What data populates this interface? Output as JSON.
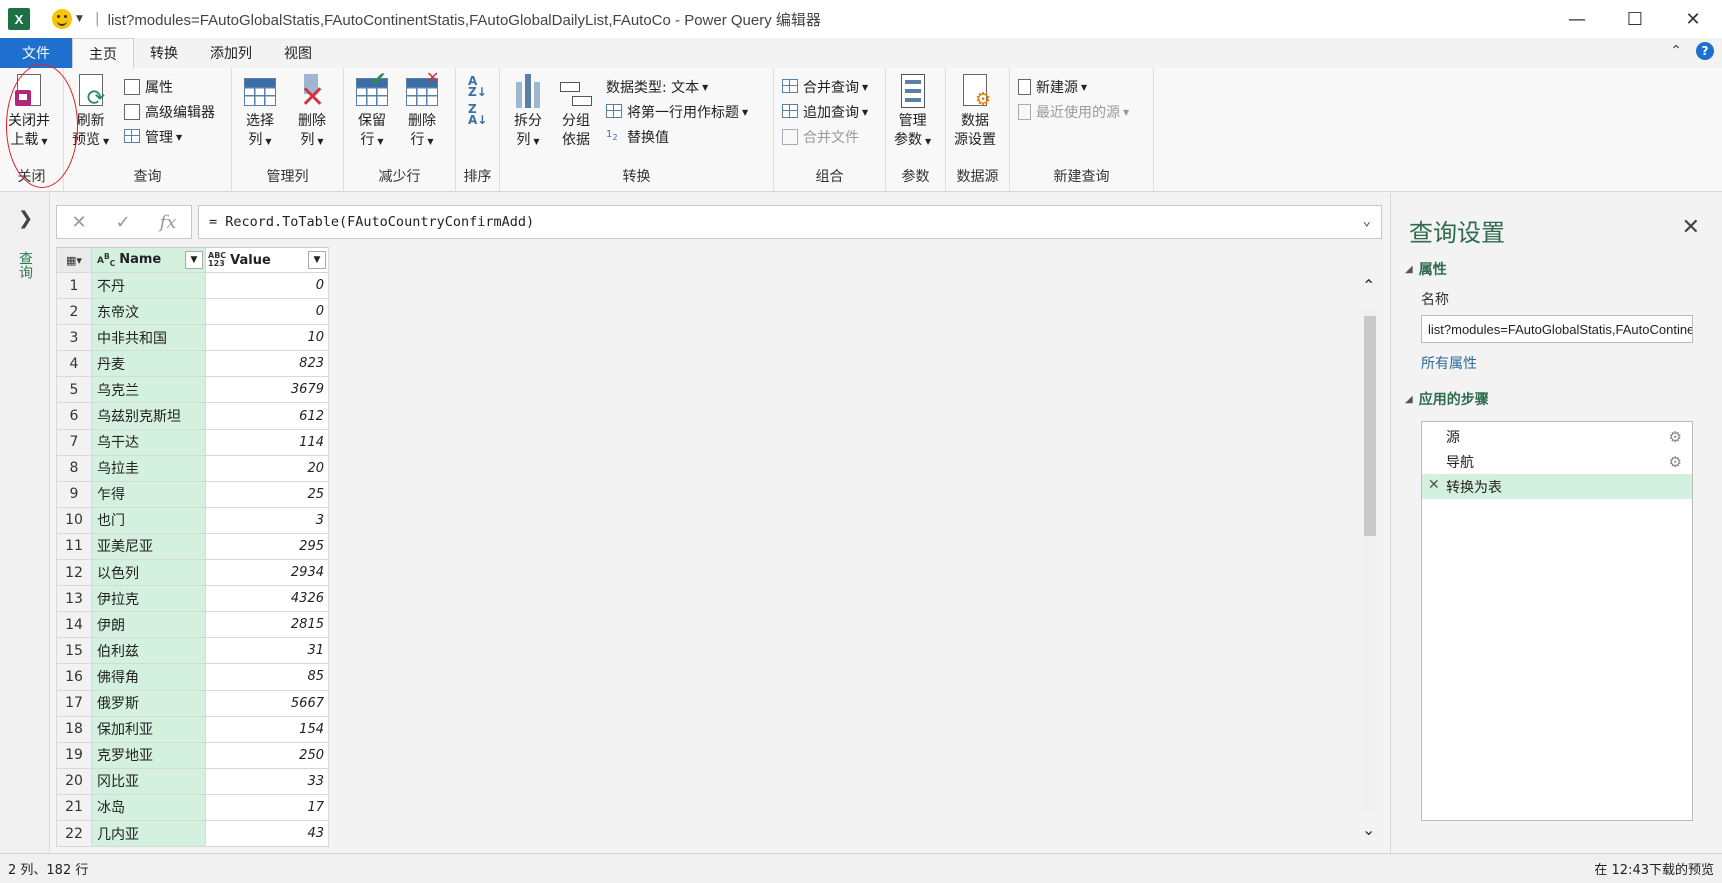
{
  "titlebar": {
    "app_icon": "excel-icon",
    "title": "list?modules=FAutoGlobalStatis,FAutoContinentStatis,FAutoGlobalDailyList,FAutoCo - Power Query 编辑器"
  },
  "tabs": {
    "file": "文件",
    "items": [
      {
        "label": "主页",
        "active": true
      },
      {
        "label": "转换"
      },
      {
        "label": "添加列"
      },
      {
        "label": "视图"
      }
    ]
  },
  "ribbon": {
    "close": {
      "btn_line1": "关闭并",
      "btn_line2": "上载",
      "label": "关闭"
    },
    "query": {
      "refresh_line1": "刷新",
      "refresh_line2": "预览",
      "properties": "属性",
      "advanced_editor": "高级编辑器",
      "manage": "管理",
      "label": "查询"
    },
    "manage_columns": {
      "choose_line1": "选择",
      "choose_line2": "列",
      "remove_line1": "删除",
      "remove_line2": "列",
      "label": "管理列"
    },
    "reduce_rows": {
      "keep_line1": "保留",
      "keep_line2": "行",
      "remove_line1": "删除",
      "remove_line2": "行",
      "label": "减少行"
    },
    "sort": {
      "label": "排序"
    },
    "transform": {
      "split_line1": "拆分",
      "split_line2": "列",
      "group_line1": "分组",
      "group_line2": "依据",
      "data_type": "数据类型: 文本",
      "first_row_header": "将第一行用作标题",
      "replace_values": "替换值",
      "label": "转换"
    },
    "combine": {
      "merge_queries": "合并查询",
      "append_queries": "追加查询",
      "combine_files": "合并文件",
      "label": "组合"
    },
    "params": {
      "manage_line1": "管理",
      "manage_line2": "参数",
      "label": "参数"
    },
    "datasource": {
      "settings_line1": "数据",
      "settings_line2": "源设置",
      "label": "数据源"
    },
    "new_query": {
      "new_source": "新建源",
      "recent_sources": "最近使用的源",
      "label": "新建查询"
    }
  },
  "leftrail": {
    "label": "查询"
  },
  "formula": {
    "text": "= Record.ToTable(FAutoCountryConfirmAdd)"
  },
  "grid": {
    "columns": [
      {
        "name": "Name",
        "type_icon": "ABC"
      },
      {
        "name": "Value",
        "type_icon": "ABC 123"
      }
    ],
    "rows": [
      [
        "1",
        "不丹",
        "0"
      ],
      [
        "2",
        "东帝汶",
        "0"
      ],
      [
        "3",
        "中非共和国",
        "10"
      ],
      [
        "4",
        "丹麦",
        "823"
      ],
      [
        "5",
        "乌克兰",
        "3679"
      ],
      [
        "6",
        "乌兹别克斯坦",
        "612"
      ],
      [
        "7",
        "乌干达",
        "114"
      ],
      [
        "8",
        "乌拉圭",
        "20"
      ],
      [
        "9",
        "乍得",
        "25"
      ],
      [
        "10",
        "也门",
        "3"
      ],
      [
        "11",
        "亚美尼亚",
        "295"
      ],
      [
        "12",
        "以色列",
        "2934"
      ],
      [
        "13",
        "伊拉克",
        "4326"
      ],
      [
        "14",
        "伊朗",
        "2815"
      ],
      [
        "15",
        "伯利兹",
        "31"
      ],
      [
        "16",
        "佛得角",
        "85"
      ],
      [
        "17",
        "俄罗斯",
        "5667"
      ],
      [
        "18",
        "保加利亚",
        "154"
      ],
      [
        "19",
        "克罗地亚",
        "250"
      ],
      [
        "20",
        "冈比亚",
        "33"
      ],
      [
        "21",
        "冰岛",
        "17"
      ],
      [
        "22",
        "几内亚",
        "43"
      ]
    ]
  },
  "query_settings": {
    "title": "查询设置",
    "properties_header": "属性",
    "name_label": "名称",
    "name_value": "list?modules=FAutoGlobalStatis,FAutoContinentStatis,FAutoGlobalDailyList,FAutoCo",
    "all_properties": "所有属性",
    "steps_header": "应用的步骤",
    "steps": [
      {
        "label": "源",
        "gear": true
      },
      {
        "label": "导航",
        "gear": true
      },
      {
        "label": "转换为表",
        "active": true
      }
    ]
  },
  "status": {
    "left": "2 列、182 行",
    "right": "在 12:43下载的预览"
  },
  "colors": {
    "accent_green": "#2e6b4f",
    "file_blue": "#1f6fcf",
    "selected_green": "#d4f0de"
  }
}
